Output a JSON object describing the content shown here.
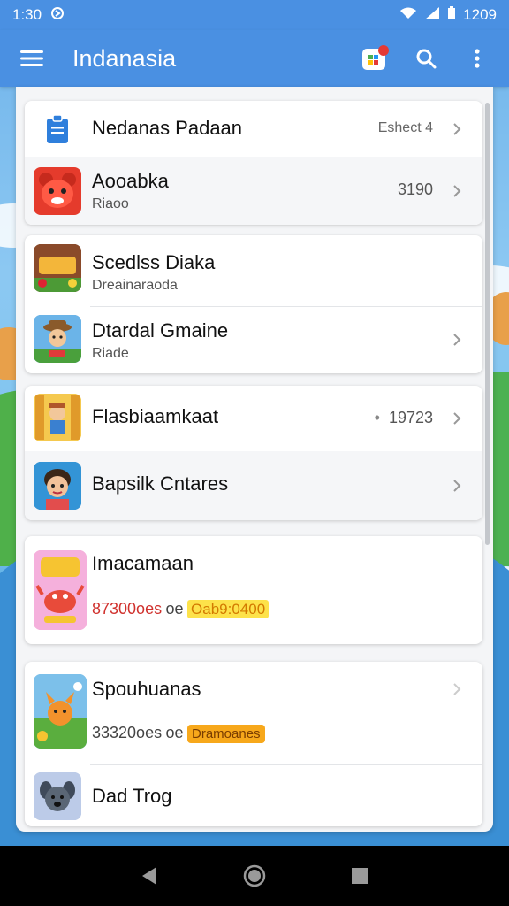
{
  "status_bar": {
    "time": "1:30",
    "battery_text": "1209"
  },
  "app_bar": {
    "title": "Indanasia",
    "notification_badge": "c"
  },
  "groups": [
    {
      "items": [
        {
          "name": "Nedanas Padaan",
          "meta": "Eshect 4",
          "icon": "clipboard-icon"
        },
        {
          "name": "Aooabka",
          "sub": "Riaoo",
          "meta": "3190",
          "icon": "red-bear-app-icon"
        }
      ]
    },
    {
      "items": [
        {
          "name": "Scedlss Diaka",
          "sub": "Dreainaraoda",
          "icon": "game-app-icon"
        },
        {
          "name": "Dtardal Gmaine",
          "sub": "Riade",
          "icon": "cowboy-game-icon"
        }
      ]
    },
    {
      "items": [
        {
          "name": "Flasbiaamkaat",
          "meta": "19723",
          "meta_prefix": "•",
          "icon": "adventure-game-icon"
        },
        {
          "name": "Bapsilk Cntares",
          "icon": "character-avatar-icon"
        }
      ]
    },
    {
      "items": [
        {
          "name": "Imacamaan",
          "price_main": "87300oes",
          "price_mid": "oe",
          "price_tag": "Oab9:0400",
          "icon": "crab-game-icon"
        }
      ]
    },
    {
      "items": [
        {
          "name": "Spouhuanas",
          "price_main": "33320oes",
          "price_mid": "oe",
          "price_tag": "Dramoanes",
          "icon": "fox-game-icon"
        },
        {
          "name": "Dad Trog",
          "icon": "dog-avatar-icon"
        }
      ]
    }
  ],
  "colors": {
    "primary": "#4a90e2",
    "card": "#ffffff",
    "panel": "#f4f5f7",
    "price_red": "#d0312d",
    "tag_yellow": "#fde24a"
  }
}
